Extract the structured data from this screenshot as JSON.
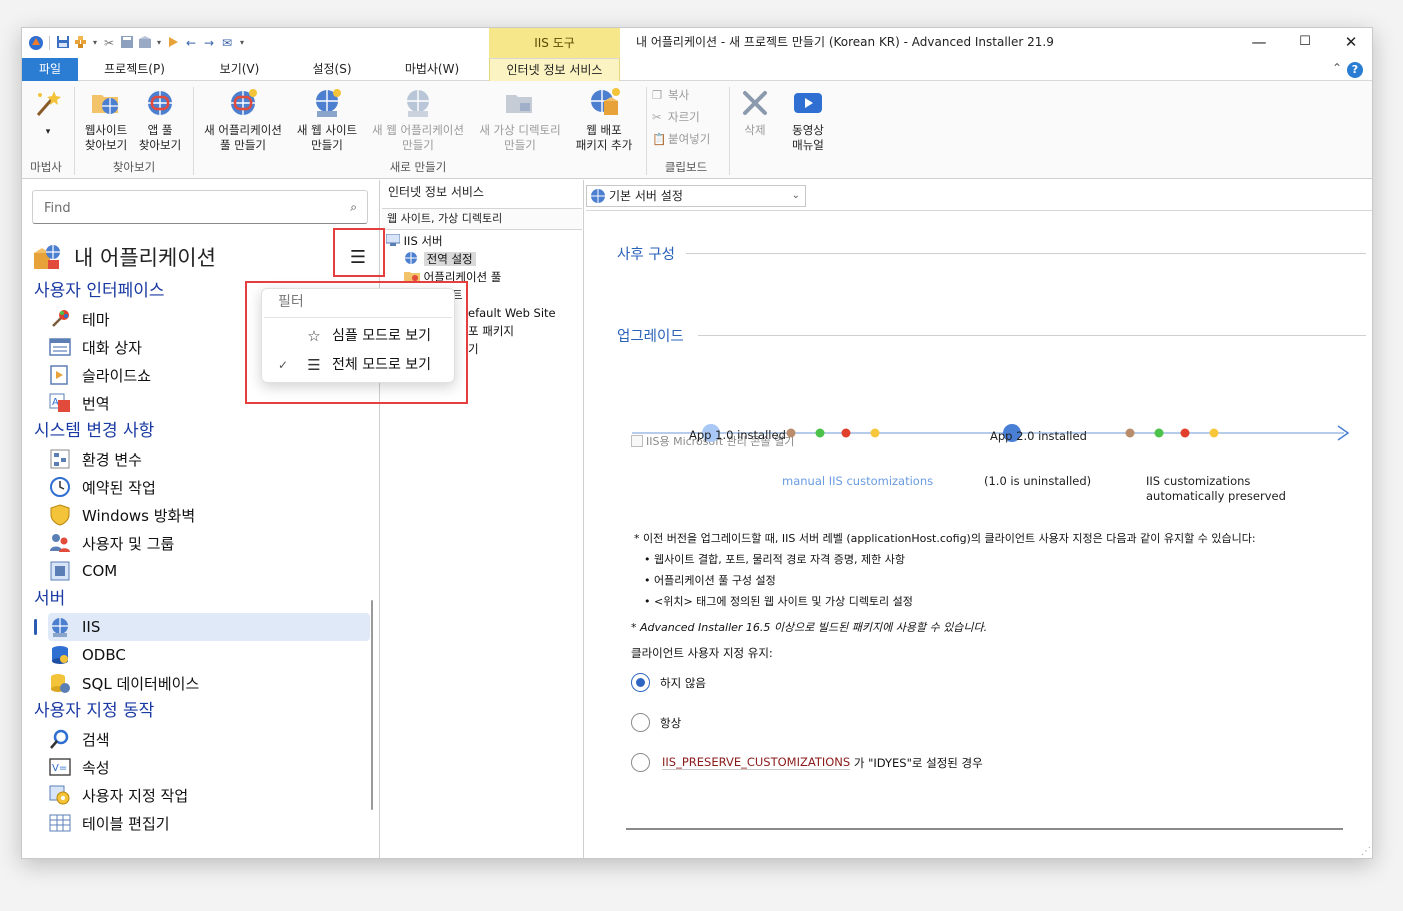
{
  "window": {
    "title": "내 어플리케이션 - 새 프로젝트 만들기 (Korean KR) - Advanced Installer 21.9",
    "context_tab_group": "IIS 도구",
    "controls": {
      "minimize": "—",
      "maximize": "☐",
      "close": "✕"
    }
  },
  "menu": {
    "tabs": [
      {
        "label": "파일",
        "kind": "file"
      },
      {
        "label": "프로젝트(P)"
      },
      {
        "label": "보기(V)"
      },
      {
        "label": "설정(S)"
      },
      {
        "label": "마법사(W)"
      },
      {
        "label": "인터넷 정보 서비스",
        "kind": "active-context"
      }
    ],
    "help": "?",
    "collapse": "⌃"
  },
  "ribbon": {
    "buttons": [
      {
        "label": "",
        "icon": "wizard-wand-icon",
        "arrow": "▾"
      },
      {
        "line1": "웹사이트",
        "line2": "찾아보기",
        "icon": "browse-website-icon"
      },
      {
        "line1": "앱 풀",
        "line2": "찾아보기",
        "icon": "browse-app-pool-icon"
      },
      {
        "line1": "새 어플리케이션",
        "line2": "풀 만들기",
        "icon": "new-app-pool-icon"
      },
      {
        "line1": "새 웹 사이트",
        "line2": "만들기",
        "icon": "new-website-icon"
      },
      {
        "line1": "새 웹 어플리케이션",
        "line2": "만들기",
        "icon": "new-web-app-icon",
        "disabled": true
      },
      {
        "line1": "새 가상 디렉토리",
        "line2": "만들기",
        "icon": "new-virtual-dir-icon",
        "disabled": true
      },
      {
        "line1": "웹 배포",
        "line2": "패키지 추가",
        "icon": "web-deploy-package-icon"
      },
      {
        "line1": "삭제",
        "line2": "",
        "icon": "delete-icon",
        "disabled": true
      },
      {
        "line1": "동영상",
        "line2": "매뉴얼",
        "icon": "video-manual-icon"
      }
    ],
    "clipboard": [
      {
        "label": "복사",
        "icon": "copy-icon"
      },
      {
        "label": "자르기",
        "icon": "cut-icon"
      },
      {
        "label": "붙여넣기",
        "icon": "paste-icon"
      }
    ],
    "groups": [
      "마법사",
      "찾아보기",
      "새로 만들기",
      "클립보드"
    ]
  },
  "left": {
    "search_placeholder": "Find",
    "app_title": "내 어플리케이션",
    "categories": [
      {
        "label": "사용자 인터페이스",
        "items": [
          {
            "label": "테마",
            "icon": "theme-icon"
          },
          {
            "label": "대화 상자",
            "icon": "dialog-icon"
          },
          {
            "label": "슬라이드쇼",
            "icon": "slideshow-icon"
          },
          {
            "label": "번역",
            "icon": "translation-icon"
          }
        ]
      },
      {
        "label": "시스템 변경 사항",
        "items": [
          {
            "label": "환경 변수",
            "icon": "env-variables-icon"
          },
          {
            "label": "예약된 작업",
            "icon": "scheduled-task-icon"
          },
          {
            "label": "Windows 방화벽",
            "icon": "firewall-icon"
          },
          {
            "label": "사용자 및 그룹",
            "icon": "users-groups-icon"
          },
          {
            "label": "COM",
            "icon": "com-icon"
          }
        ]
      },
      {
        "label": "서버",
        "items": [
          {
            "label": "IIS",
            "icon": "iis-icon",
            "selected": true
          },
          {
            "label": "ODBC",
            "icon": "odbc-icon"
          },
          {
            "label": "SQL 데이터베이스",
            "icon": "sql-database-icon"
          }
        ]
      },
      {
        "label": "사용자 지정 동작",
        "items": [
          {
            "label": "검색",
            "icon": "search-icon"
          },
          {
            "label": "속성",
            "icon": "properties-icon"
          },
          {
            "label": "사용자 지정 작업",
            "icon": "custom-action-icon"
          },
          {
            "label": "테이블 편집기",
            "icon": "table-editor-icon"
          }
        ]
      }
    ]
  },
  "filter_popup": {
    "title": "필터",
    "items": [
      {
        "label": "심플 모드로 보기",
        "icon": "star-list-icon",
        "checked": false
      },
      {
        "label": "전체 모드로 보기",
        "icon": "full-list-icon",
        "checked": true
      }
    ],
    "check_mark": "✓"
  },
  "middle": {
    "title": "인터넷 정보 서비스",
    "path": "웹 사이트, 가상 디렉토리",
    "tree": [
      {
        "label": "IIS 서버",
        "level": 0
      },
      {
        "label": "전역 설정",
        "level": 1,
        "selected": true
      },
      {
        "label": "어플리케이션 풀",
        "level": 1
      },
      {
        "label": "트",
        "level": 1
      },
      {
        "label": "efault Web Site",
        "level": 1
      },
      {
        "label": "포 패키지",
        "level": 1
      },
      {
        "label": "기",
        "level": 1
      }
    ]
  },
  "right": {
    "dropdown": "기본 서버 설정",
    "post_config": {
      "title": "사후 구성",
      "checkbox": "IIS용 Microsoft 관리 콘솔 열기"
    },
    "upgrade": {
      "title": "업그레이드",
      "diagram": {
        "app1": "App 1.0 installed",
        "app2": "App 2.0 installed",
        "manual": "manual IIS customizations",
        "uninstalled": "(1.0 is uninstalled)",
        "preserved_line1": "IIS customizations",
        "preserved_line2": "automatically preserved",
        "dot_colors": [
          "#b98d6c",
          "#4cc24a",
          "#e0402c",
          "#f7c63a"
        ],
        "main_dot_color": "#4a7fd6",
        "first_dot_color": "#a9c8f5"
      },
      "notes": [
        "* 이전 버전을 업그레이드할 때, IIS 서버 레벨 (applicationHost.cofig)의 클라이언트 사용자 지정은 다음과 같이 유지할 수 있습니다:",
        "• 웹사이트 결합, 포트, 물리적 경로 자격 증명, 제한 사항",
        "• 어플리케이션 풀 구성 설정",
        "• <위치> 태그에 정의된 웹 사이트 및 가상 디렉토리 설정"
      ],
      "italic_note": "* Advanced Installer 16.5 이상으로 빌드된 패키지에 사용할 수 있습니다.",
      "preserve_label": "클라이언트 사용자 지정 유지:",
      "options": [
        {
          "label": "하지 않음",
          "selected": true
        },
        {
          "label": "항상",
          "selected": false
        }
      ],
      "conditional": {
        "prop": "IIS_PRESERVE_CUSTOMIZATIONS",
        "suffix": " 가 \"IDYES\"로 설정된 경우"
      }
    }
  },
  "colors": {
    "accent": "#2b7cd3",
    "category": "#1a3aa3",
    "highlight": "#e53e3e",
    "context_tab": "#f5e78a"
  }
}
